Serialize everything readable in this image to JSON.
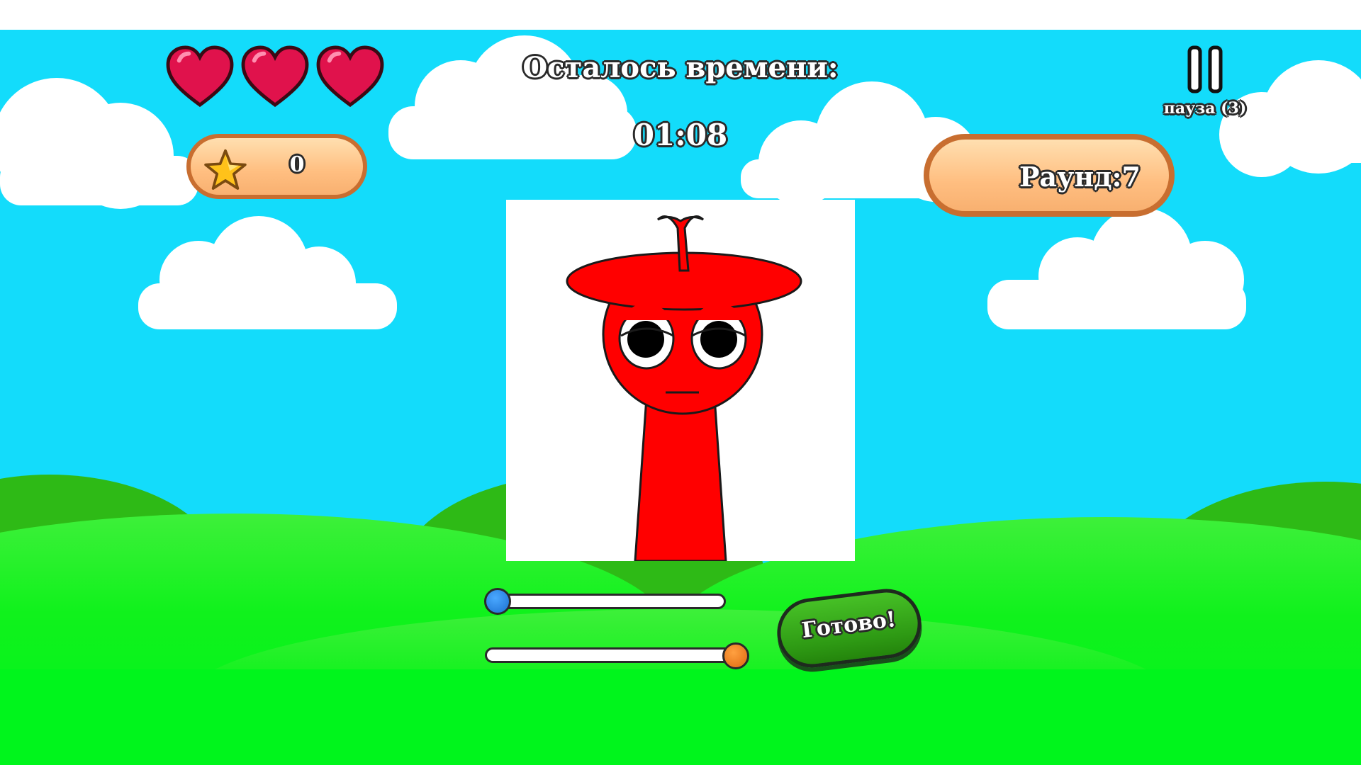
{
  "hud": {
    "lives": 3,
    "timer_label": "Осталось времени:",
    "timer_value": "01:08",
    "score": "0",
    "round_label": "Раунд:7",
    "pause_label": "пауза (3)"
  },
  "sliders": [
    {
      "color": "#1b6fd0",
      "level": 0.0
    },
    {
      "color": "#e06a10",
      "level": 1.0
    }
  ],
  "done_button": {
    "label": "Готово!"
  },
  "colors": {
    "sky": "#13dcfb",
    "grass": "#00f51c",
    "character_red": "#ff0000",
    "pill_border": "#c86e30",
    "heart": "#e0124c"
  }
}
